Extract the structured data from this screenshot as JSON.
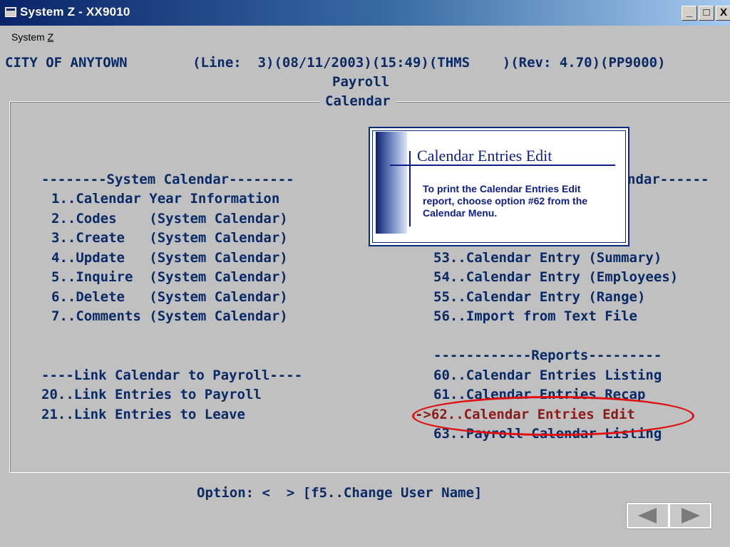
{
  "window": {
    "title": "System Z - XX9010",
    "buttons": {
      "minimize": "_",
      "maximize": "□",
      "close": "X"
    }
  },
  "menu": {
    "system_prefix": "System ",
    "system_hotkey": "Z"
  },
  "header": {
    "line1": "CITY OF ANYTOWN        (Line:  3)(08/11/2003)(15:49)(THMS    )(Rev: 4.70)(PP9000)",
    "module": "Payroll",
    "screen": "Calendar"
  },
  "left": {
    "system_heading": "--------System Calendar--------",
    "items": [
      "1..Calendar Year Information",
      "2..Codes    (System Calendar)",
      "3..Create   (System Calendar)",
      "4..Update   (System Calendar)",
      "5..Inquire  (System Calendar)",
      "6..Delete   (System Calendar)",
      "7..Comments (System Calendar)"
    ],
    "link_heading": "----Link Calendar to Payroll----",
    "link_items": [
      "20..Link Entries to Payroll",
      "21..Link Entries to Leave"
    ]
  },
  "right": {
    "heading_partial": "ndar------",
    "items": [
      "53..Calendar Entry (Summary)",
      "54..Calendar Entry (Employees)",
      "55..Calendar Entry (Range)",
      "56..Import from Text File"
    ],
    "reports_heading": "------------Reports---------",
    "reports": [
      "60..Calendar Entries Listing",
      "61..Calendar Entries Recap",
      "->62..Calendar Entries Edit",
      "63..Payroll Calendar Listing"
    ]
  },
  "prompt": "Option: <  > [f5..Change User Name]",
  "callout": {
    "title": "Calendar Entries Edit",
    "body": "To print the Calendar Entries Edit report, choose option #62 from the Calendar Menu."
  },
  "colors": {
    "terminal_text": "#0a2a66",
    "selected_text": "#8b1a1a",
    "highlight_ellipse": "#e01010",
    "callout_text": "#10208a"
  }
}
